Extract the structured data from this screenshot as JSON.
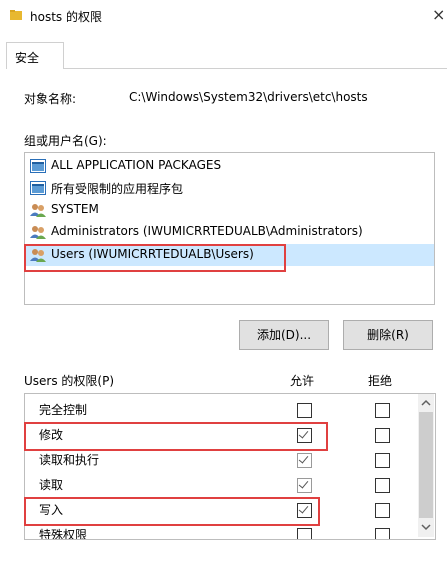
{
  "window": {
    "title": "hosts 的权限",
    "close_glyph": "×"
  },
  "tab": {
    "label": "安全"
  },
  "object": {
    "label": "对象名称:",
    "value": "C:\\Windows\\System32\\drivers\\etc\\hosts"
  },
  "groups": {
    "label": "组或用户名(G):",
    "items": [
      {
        "label": "ALL APPLICATION PACKAGES",
        "icon": "app-packages-icon"
      },
      {
        "label": "所有受限制的应用程序包",
        "icon": "app-packages-icon"
      },
      {
        "label": "SYSTEM",
        "icon": "users-group-icon"
      },
      {
        "label": "Administrators (IWUMICRRTEDUALB\\Administrators)",
        "icon": "users-group-icon"
      },
      {
        "label": "Users (IWUMICRRTEDUALB\\Users)",
        "icon": "users-group-icon"
      }
    ]
  },
  "buttons": {
    "add": "添加(D)...",
    "remove": "删除(R)"
  },
  "perms": {
    "label": "Users 的权限(P)",
    "allow": "允许",
    "deny": "拒绝",
    "rows": [
      {
        "name": "完全控制",
        "allow": false,
        "deny": false
      },
      {
        "name": "修改",
        "allow": true,
        "deny": false
      },
      {
        "name": "读取和执行",
        "allow": true,
        "deny": false
      },
      {
        "name": "读取",
        "allow": true,
        "deny": false
      },
      {
        "name": "写入",
        "allow": true,
        "deny": false
      },
      {
        "name": "特殊权限",
        "allow": false,
        "deny": false
      }
    ]
  },
  "colors": {
    "highlight": "#e04040",
    "accent_folder": "#e8b830",
    "selected_row": "#cce8ff"
  }
}
